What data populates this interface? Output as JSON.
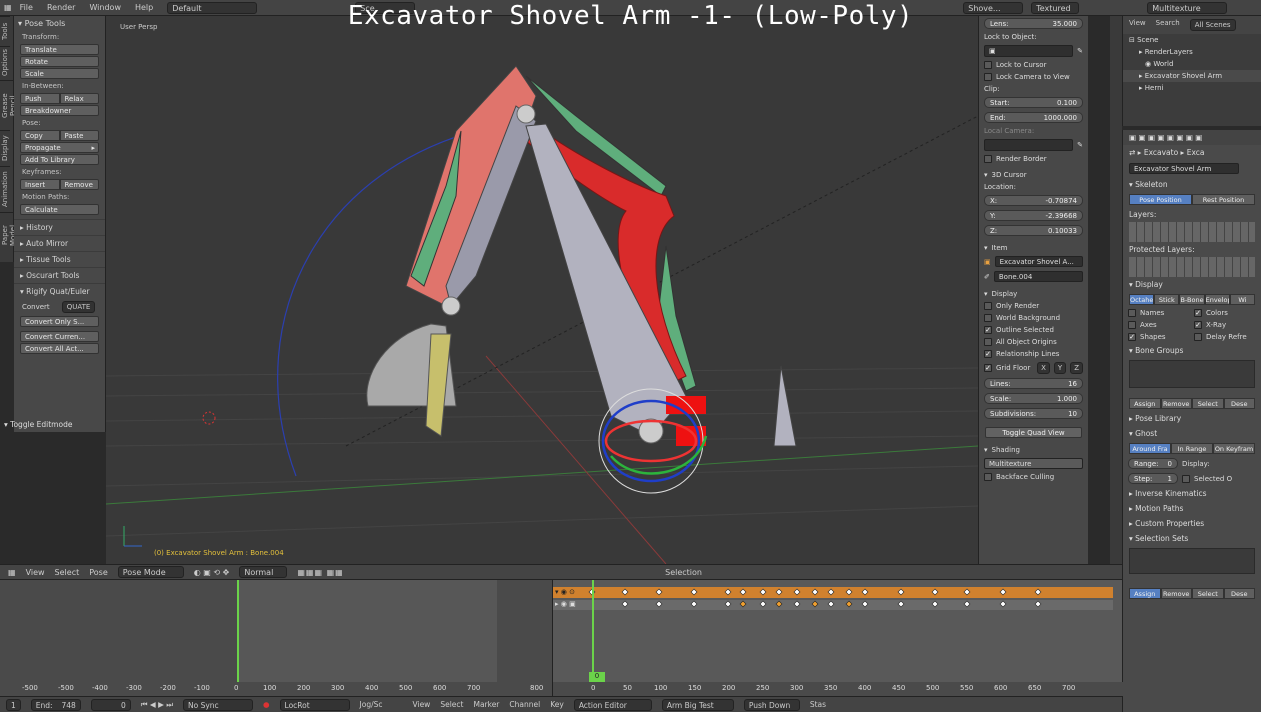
{
  "overlay_title": "Excavator Shovel Arm -1- (Low-Poly)",
  "topbar": {
    "menus": [
      "File",
      "Render",
      "Window",
      "Help"
    ],
    "layout": "Default",
    "scene_short": "Sce",
    "engine_short": "Shove...",
    "shading": "Textured",
    "right_shading": "Multitexture"
  },
  "vtabs": [
    "Tools",
    "Options",
    "Grease Pencil",
    "Display",
    "Animation",
    "Paper Model"
  ],
  "toolshelf": {
    "title": "Pose Tools",
    "transform_label": "Transform:",
    "translate": "Translate",
    "rotate": "Rotate",
    "scale": "Scale",
    "inbetween_label": "In-Between:",
    "push": "Push",
    "relax": "Relax",
    "breakdowner": "Breakdowner",
    "pose_label": "Pose:",
    "copy": "Copy",
    "paste": "Paste",
    "propagate": "Propagate",
    "add_to_library": "Add To Library",
    "keyframes_label": "Keyframes:",
    "insert": "Insert",
    "remove": "Remove",
    "motion_paths_label": "Motion Paths:",
    "calculate": "Calculate",
    "panels": [
      "History",
      "Auto Mirror",
      "Tissue Tools",
      "Oscurart Tools",
      "Rigify Quat/Euler"
    ],
    "convert_label": "Convert",
    "convert_value": "QUATE",
    "convert_only": "Convert Only S...",
    "convert_current": "Convert Curren...",
    "convert_all": "Convert All Act...",
    "toggle_editmode": "Toggle Editmode"
  },
  "viewport": {
    "label": "User Persp",
    "status": "(0) Excavator Shovel Arm : Bone.004"
  },
  "npanel": {
    "lens_label": "Lens:",
    "lens_value": "35.000",
    "lock_to_object": "Lock to Object:",
    "lock_to_cursor": "Lock to Cursor",
    "lock_camera": "Lock Camera to View",
    "clip_label": "Clip:",
    "start_label": "Start:",
    "start_value": "0.100",
    "end_label": "End:",
    "end_value": "1000.000",
    "local_camera": "Local Camera:",
    "render_border": "Render Border",
    "cursor_title": "3D Cursor",
    "location_label": "Location:",
    "x_label": "X:",
    "x_value": "-0.70874",
    "y_label": "Y:",
    "y_value": "-2.39668",
    "z_label": "Z:",
    "z_value": "0.10033",
    "item_title": "Item",
    "item_object": "Excavator Shovel A...",
    "item_bone": "Bone.004",
    "display_title": "Display",
    "only_render": "Only Render",
    "world_background": "World Background",
    "outline_selected": "Outline Selected",
    "all_object_origins": "All Object Origins",
    "relationship_lines": "Relationship Lines",
    "grid_floor": "Grid Floor",
    "axis_x": "X",
    "axis_y": "Y",
    "axis_z": "Z",
    "lines_label": "Lines:",
    "lines_value": "16",
    "scale_label": "Scale:",
    "scale_value": "1.000",
    "subdiv_label": "Subdivisions:",
    "subdiv_value": "10",
    "toggle_quad": "Toggle Quad View",
    "shading_title": "Shading",
    "shading_value": "Multitexture",
    "backface": "Backface Culling"
  },
  "outliner": {
    "view": "View",
    "search": "Search",
    "all_scenes": "All Scenes",
    "items": [
      "Scene",
      "RenderLayers",
      "World",
      "Excavator Shovel Arm",
      "Herni"
    ]
  },
  "props": {
    "crumb_1": "Excavato",
    "crumb_2": "Exca",
    "name_field": "Excavator Shovel Arm",
    "skeleton_title": "Skeleton",
    "pose_position": "Pose Position",
    "rest_position": "Rest Position",
    "layers_label": "Layers:",
    "protected_label": "Protected Layers:",
    "display_title": "Display",
    "display_modes": [
      "Octahed",
      "Stick",
      "B-Bone",
      "Envelop",
      "Wi"
    ],
    "names": "Names",
    "colors": "Colors",
    "axes": "Axes",
    "xray": "X-Ray",
    "shapes": "Shapes",
    "delay_refresh": "Delay Refre",
    "bone_groups_title": "Bone Groups",
    "assign": "Assign",
    "remove": "Remove",
    "select": "Select",
    "deselect": "Dese",
    "pose_library": "Pose Library",
    "ghost_title": "Ghost",
    "ghost_modes": [
      "Around Fra",
      "In Range",
      "On Keyfram"
    ],
    "range_label": "Range:",
    "range_value": "0",
    "step_label": "Step:",
    "step_value": "1",
    "display_label": "Display:",
    "selected_only": "Selected O",
    "inverse_kinematics": "Inverse Kinematics",
    "motion_paths": "Motion Paths",
    "custom_properties": "Custom Properties",
    "selection_sets": "Selection Sets",
    "bottom_assign": "Assign",
    "bottom_remove": "Remove",
    "bottom_select": "Select",
    "bottom_deselect": "Dese"
  },
  "vp_header": {
    "view": "View",
    "select": "Select",
    "pose": "Pose",
    "mode": "Pose Mode",
    "pivot": "Normal",
    "selection": "Selection"
  },
  "timeline": {
    "ticks": [
      "-500",
      "-500",
      "-400",
      "-300",
      "-200",
      "-100",
      "0",
      "100",
      "200",
      "300",
      "400",
      "500",
      "600",
      "700",
      "800"
    ],
    "current_frame": "0"
  },
  "dopesheet": {
    "ticks": [
      "0",
      "50",
      "100",
      "150",
      "200",
      "250",
      "300",
      "350",
      "400",
      "450",
      "500",
      "550",
      "600",
      "650",
      "700"
    ],
    "current_frame": "0"
  },
  "bottom_bar": {
    "frame": "1",
    "end_label": "End:",
    "end_value": "748",
    "current": "0",
    "sync": "No Sync",
    "keying": "LocRot",
    "keying_short": "Jog/Sc",
    "view": "View",
    "select": "Select",
    "marker": "Marker",
    "channel": "Channel",
    "key": "Key",
    "editor": "Action Editor",
    "action": "Arm Big Test",
    "push_down": "Push Down",
    "stash": "Stas"
  }
}
